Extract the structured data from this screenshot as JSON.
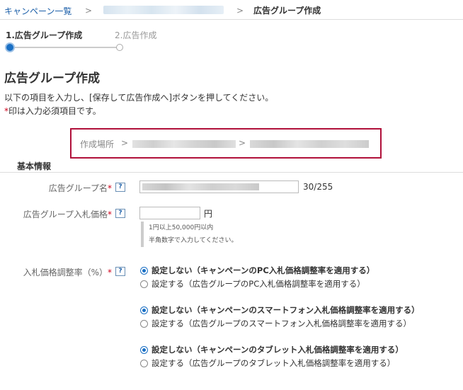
{
  "breadcrumb": {
    "root": "キャンペーン一覧",
    "sep": ">",
    "current": "広告グループ作成"
  },
  "steps": {
    "step1": "1.広告グループ作成",
    "step2": "2.広告作成"
  },
  "page": {
    "title": "広告グループ作成",
    "description": "以下の項目を入力し、[保存して広告作成へ]ボタンを押してください。",
    "required_mark": "*",
    "required_note": "印は入力必須項目です。"
  },
  "location": {
    "label": "作成場所",
    "sep": ">"
  },
  "section": {
    "title": "基本情報"
  },
  "fields": {
    "required_mark": "*",
    "help": "?",
    "name_label": "広告グループ名",
    "name_count": "30/255",
    "bid_label": "広告グループ入札価格",
    "bid_unit": "円",
    "bid_hint1": "1円以上50,000円以内",
    "bid_hint2": "半角数字で入力してください。",
    "adj_label": "入札価格調整率（%）"
  },
  "radios": {
    "pc_default": "設定しない（キャンペーンのPC入札価格調整率を適用する）",
    "pc_set": "設定する（広告グループのPC入札価格調整率を適用する）",
    "sp_default": "設定しない（キャンペーンのスマートフォン入札価格調整率を適用する）",
    "sp_set": "設定する（広告グループのスマートフォン入札価格調整率を適用する）",
    "tab_default": "設定しない（キャンペーンのタブレット入札価格調整率を適用する）",
    "tab_set": "設定する（広告グループのタブレット入札価格調整率を適用する）"
  },
  "colors": {
    "link": "#1a5ea8",
    "accent": "#1a6fc4",
    "required": "#d0021b",
    "highlight_border": "#b0103a"
  }
}
